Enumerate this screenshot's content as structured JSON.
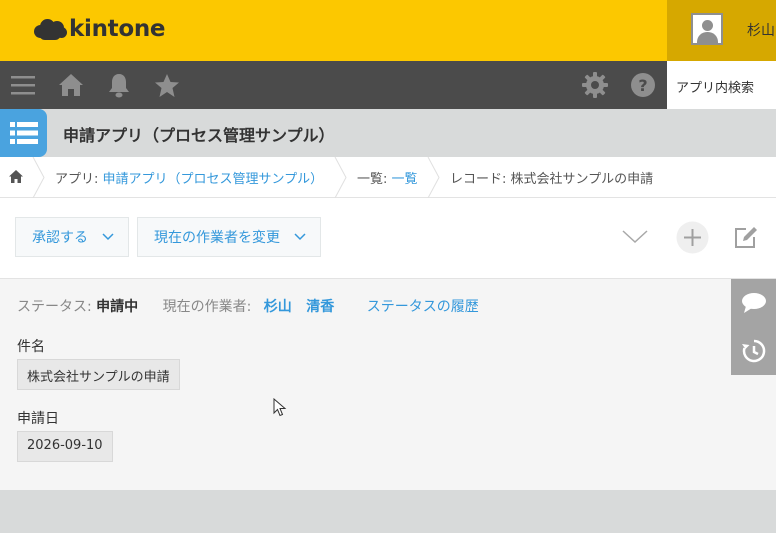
{
  "header": {
    "logo_text": "kintone",
    "user_name": "杉山",
    "search_placeholder": "アプリ内検索"
  },
  "nav": {
    "icons": [
      "menu-icon",
      "home-icon",
      "bell-icon",
      "star-icon",
      "gear-icon",
      "help-icon"
    ]
  },
  "app": {
    "title": "申請アプリ（プロセス管理サンプル）"
  },
  "breadcrumb": {
    "app_prefix": "アプリ: ",
    "app_link": "申請アプリ（プロセス管理サンプル）",
    "list_prefix": "一覧: ",
    "list_link": "一覧",
    "record": "レコード: 株式会社サンプルの申請"
  },
  "toolbar": {
    "approve_label": "承認する",
    "change_assignee_label": "現在の作業者を変更"
  },
  "record": {
    "status_label": "ステータス: ",
    "status_value": "申請中",
    "assignee_label": "現在の作業者:",
    "assignees": [
      "杉山",
      "清香"
    ],
    "history_link": "ステータスの履歴",
    "fields": [
      {
        "label": "件名",
        "value": "株式会社サンプルの申請"
      },
      {
        "label": "申請日",
        "value": "2026-09-10"
      }
    ]
  },
  "colors": {
    "header_yellow": "#fcc800",
    "nav_gray": "#4b4b4b",
    "link_blue": "#3498db",
    "app_icon_blue": "#4aa3df"
  }
}
